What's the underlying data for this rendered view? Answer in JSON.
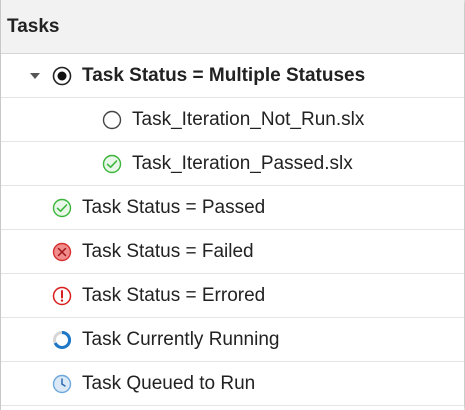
{
  "panel": {
    "title": "Tasks"
  },
  "rows": [
    {
      "label": "Task Status = Multiple Statuses",
      "icon": "radio-selected-icon",
      "expanded": true
    },
    {
      "label": "Task_Iteration_Not_Run.slx",
      "icon": "not-run-circle-icon"
    },
    {
      "label": "Task_Iteration_Passed.slx",
      "icon": "passed-check-icon"
    },
    {
      "label": "Task Status = Passed",
      "icon": "passed-check-icon"
    },
    {
      "label": "Task Status = Failed",
      "icon": "failed-x-icon"
    },
    {
      "label": "Task Status = Errored",
      "icon": "errored-exclamation-icon"
    },
    {
      "label": "Task Currently Running",
      "icon": "running-spinner-icon"
    },
    {
      "label": "Task Queued to Run",
      "icon": "queued-clock-icon"
    }
  ],
  "colors": {
    "passed": "#3cb53c",
    "failed": "#e04040",
    "errored": "#d81e1e",
    "running": "#1e78c8",
    "queued": "#6ea8dc",
    "not_run": "#444444"
  }
}
